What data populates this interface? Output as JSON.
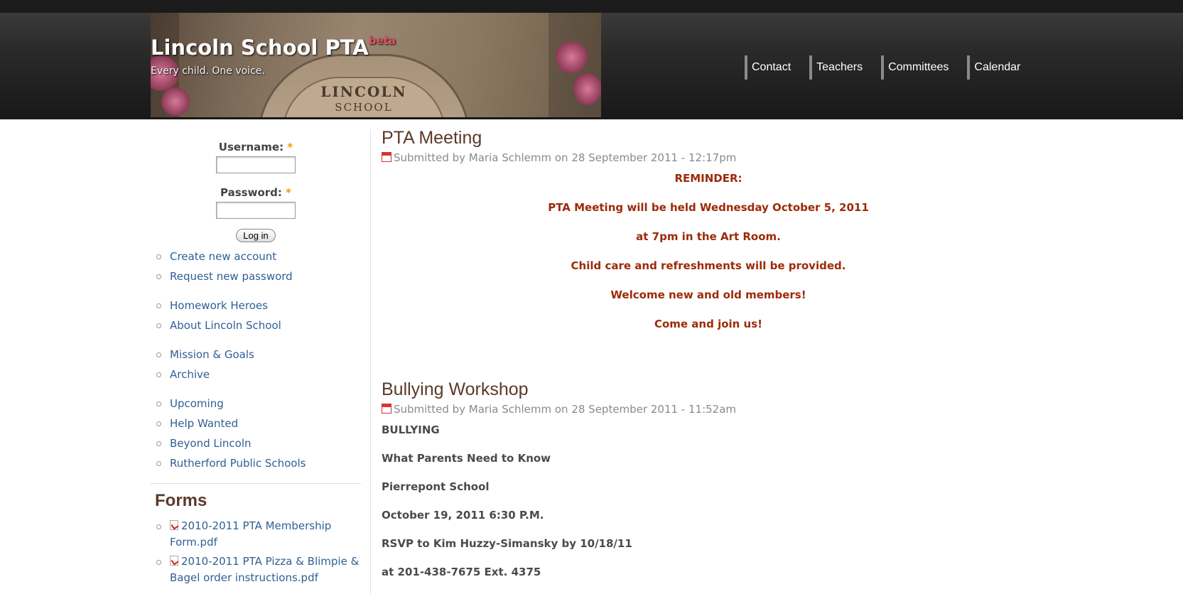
{
  "header": {
    "site_name": "Lincoln School PTA",
    "beta": "beta",
    "slogan": "Every child. One voice.",
    "banner_engraving_line1": "LINCOLN",
    "banner_engraving_line2": "SCHOOL"
  },
  "nav": [
    "Contact",
    "Teachers",
    "Committees",
    "Calendar"
  ],
  "login": {
    "username_label": "Username:",
    "password_label": "Password:",
    "required_mark": "*",
    "login_button": "Log in",
    "create_account": "Create new account",
    "request_password": "Request new password"
  },
  "menu_group1": [
    "Homework Heroes",
    "About Lincoln School"
  ],
  "menu_group2": [
    "Mission & Goals",
    "Archive"
  ],
  "menu_group3": [
    "Upcoming",
    "Help Wanted",
    "Beyond Lincoln",
    "Rutherford Public Schools"
  ],
  "forms": {
    "title": "Forms",
    "files": [
      "2010-2011 PTA Membership Form.pdf",
      "2010-2011 PTA Pizza & Blimpie & Bagel order instructions.pdf"
    ]
  },
  "posts": [
    {
      "title": "PTA Meeting",
      "submitted": "Submitted by Maria Schlemm on 28 September 2011 - 12:17pm",
      "lines": [
        "REMINDER:",
        "PTA Meeting will be held Wednesday October 5, 2011",
        "at 7pm in the Art Room.",
        "Child care and refreshments will be provided.",
        "Welcome new and old members!",
        "Come and join us!"
      ]
    },
    {
      "title": "Bullying Workshop",
      "submitted": "Submitted by Maria Schlemm on 28 September 2011 - 11:52am",
      "lines": [
        "BULLYING",
        "What Parents Need to Know",
        "Pierrepont School",
        "October 19, 2011 6:30 P.M.",
        "RSVP to Kim Huzzy-Simansky by 10/18/11",
        "at 201-438-7675 Ext. 4375"
      ]
    }
  ],
  "colors": {
    "header_dark": "#1b1b1b",
    "link": "#2f5f94",
    "title_brown": "#5a3a2a",
    "reminder_red": "#9c2a09",
    "beta_pink": "#e0566b",
    "required_orange": "#f29a00"
  },
  "icons": [
    "calendar-icon",
    "pdf-icon"
  ]
}
